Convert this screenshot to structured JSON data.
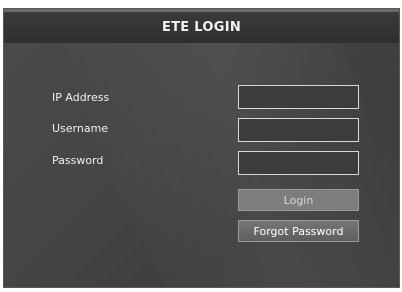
{
  "header": {
    "title": "ETE LOGIN"
  },
  "form": {
    "ip_label": "IP Address",
    "ip_value": "",
    "username_label": "Username",
    "username_value": "",
    "password_label": "Password",
    "password_value": ""
  },
  "buttons": {
    "login": "Login",
    "forgot_password": "Forgot Password"
  }
}
